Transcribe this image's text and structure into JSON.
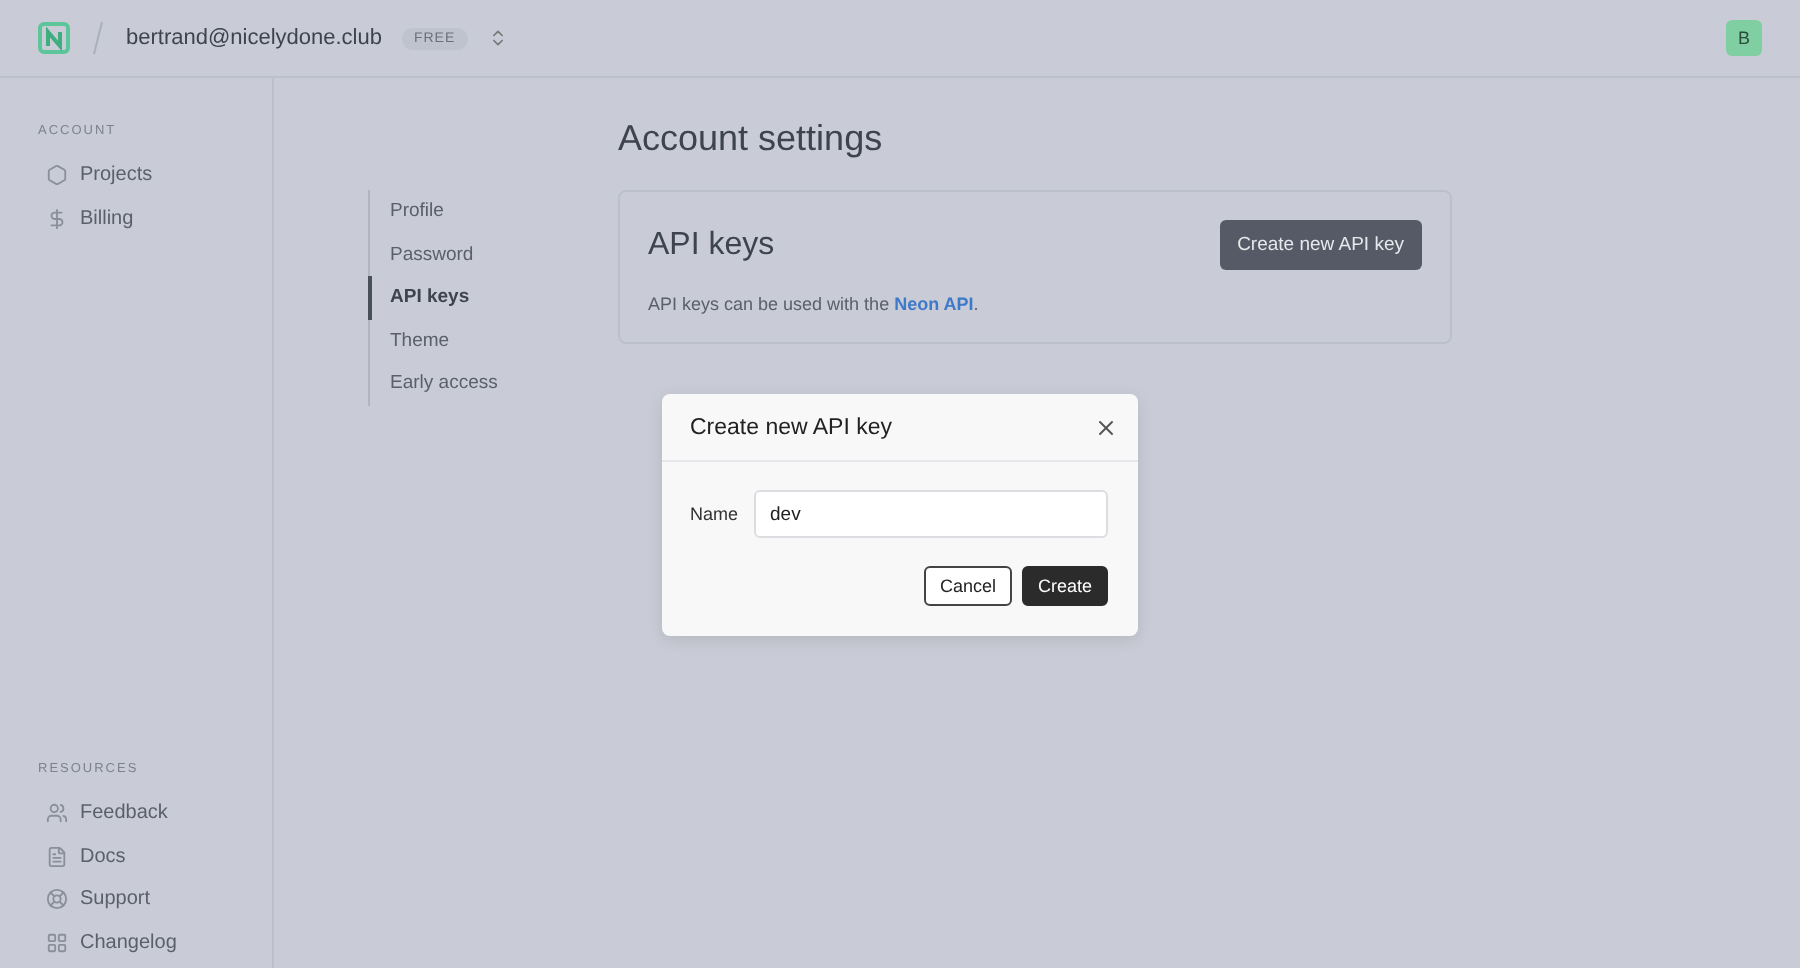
{
  "header": {
    "account": "bertrand@nicelydone.club",
    "plan": "FREE",
    "avatar": "B"
  },
  "sidebar": {
    "sections": [
      {
        "title": "ACCOUNT",
        "items": [
          {
            "label": "Projects",
            "kind": "projects"
          },
          {
            "label": "Billing",
            "kind": "billing"
          }
        ]
      },
      {
        "title": "RESOURCES",
        "items": [
          {
            "label": "Feedback",
            "kind": "feedback"
          },
          {
            "label": "Docs",
            "kind": "docs"
          },
          {
            "label": "Support",
            "kind": "support"
          },
          {
            "label": "Changelog",
            "kind": "changelog"
          }
        ]
      }
    ]
  },
  "page": {
    "title": "Account settings"
  },
  "settings_nav": [
    {
      "label": "Profile",
      "selected": false
    },
    {
      "label": "Password",
      "selected": false
    },
    {
      "label": "API keys",
      "selected": true
    },
    {
      "label": "Theme",
      "selected": false
    },
    {
      "label": "Early access",
      "selected": false
    }
  ],
  "card": {
    "title": "API keys",
    "button": "Create new API key",
    "text_before": "API keys can be used with the ",
    "link": "Neon API",
    "text_after": "."
  },
  "dialog": {
    "title": "Create new API key",
    "field_label": "Name",
    "field_value": "dev",
    "buttons": [
      {
        "label": "Cancel",
        "kind": "secondary"
      },
      {
        "label": "Create",
        "kind": "primary"
      }
    ]
  }
}
